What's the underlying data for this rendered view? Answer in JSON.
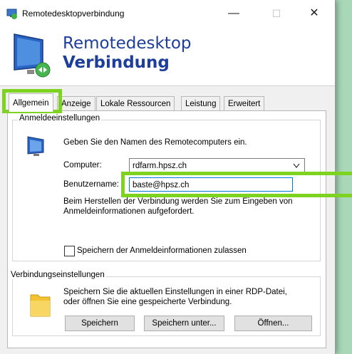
{
  "window": {
    "title": "Remotedesktopverbindung",
    "minimize": "—",
    "maximize": "☐",
    "close": "✕"
  },
  "banner": {
    "line1": "Remotedesktop",
    "line2": "Verbindung"
  },
  "tabs": [
    {
      "label": "Allgemein"
    },
    {
      "label": "Anzeige"
    },
    {
      "label": "Lokale Ressourcen"
    },
    {
      "label": "Leistung"
    },
    {
      "label": "Erweitert"
    }
  ],
  "logon": {
    "legend": "Anmeldeeinstellungen",
    "intro": "Geben Sie den Namen des Remotecomputers ein.",
    "computer_label": "Computer:",
    "computer_value": "rdfarm.hpsz.ch",
    "user_label": "Benutzername:",
    "user_value": "baste@hpsz.ch",
    "info_line1": "Beim Herstellen der Verbindung werden Sie zum Eingeben von",
    "info_line2": "Anmeldeinformationen aufgefordert.",
    "save_credentials_label": "Speichern der Anmeldeinformationen zulassen"
  },
  "connection": {
    "legend": "Verbindungseinstellungen",
    "text_line1": "Speichern Sie die aktuellen Einstellungen in einer RDP-Datei,",
    "text_line2": "oder öffnen Sie eine gespeicherte Verbindung.",
    "save_label": "Speichern",
    "save_as_label": "Speichern unter...",
    "open_label": "Öffnen..."
  },
  "colors": {
    "highlight": "#7ed321",
    "banner_text": "#1d3f9b",
    "background": "#a8d8b8"
  }
}
